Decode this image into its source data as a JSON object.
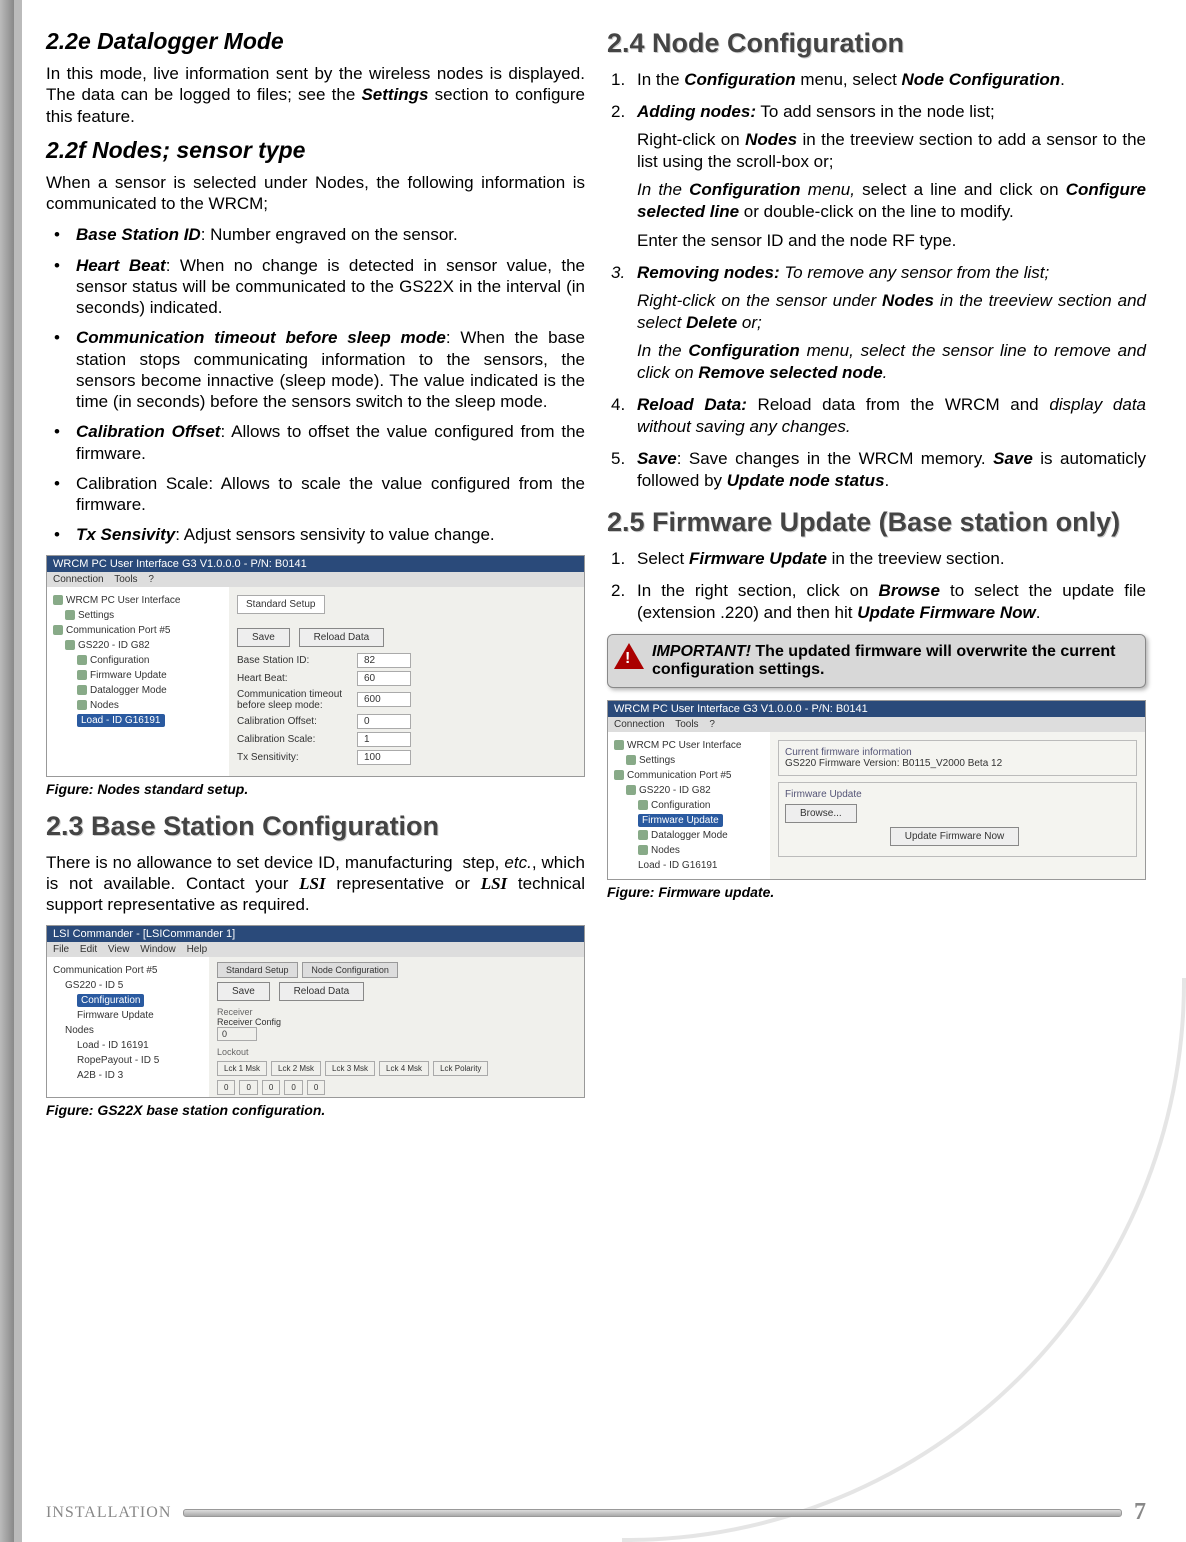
{
  "left": {
    "s22e_title": "2.2e   Datalogger Mode",
    "s22e_p": "In this mode, live information sent by the wireless nodes is displayed. The data can be logged to files; see the Settings section to configure this feature.",
    "s22f_title": "2.2f   Nodes; sensor type",
    "s22f_intro": "When a sensor is selected under Nodes, the following information is communicated to the WRCM;",
    "bullets": [
      {
        "b": "Base Station ID",
        "t": ": Number engraved on the sensor."
      },
      {
        "b": "Heart Beat",
        "t": ": When no change is detected in sensor value, the sensor status will be communicated to the GS22X in the interval (in seconds) indicated."
      },
      {
        "b": "Communication timeout before sleep mode",
        "t": ": When the base station stops communicating information to the sensors, the sensors become innactive (sleep mode). The value indicated is the time (in seconds) before the sensors switch to the sleep mode."
      },
      {
        "b": "Calibration Offset",
        "t": ": Allows to offset the value configured from the firmware."
      },
      {
        "b": "",
        "t": "Calibration Scale: Allows to scale the value configured from the firmware."
      },
      {
        "b": "Tx Sensivity",
        "t": ": Adjust sensors sensivity to value change."
      }
    ],
    "fig1_title": "WRCM PC User Interface G3 V1.0.0.0 - P/N: B0141",
    "fig1_menu": [
      "Connection",
      "Tools",
      "?"
    ],
    "fig1_tree": {
      "root": "WRCM PC User Interface",
      "settings": "Settings",
      "port": "Communication Port #5",
      "gs": "GS220 - ID G82",
      "cfg": "Configuration",
      "fw": "Firmware Update",
      "dl": "Datalogger Mode",
      "nodes": "Nodes",
      "load": "Load - ID G16191"
    },
    "fig1_panel": {
      "hdr": "Standard Setup",
      "save": "Save",
      "reload": "Reload Data",
      "f1": "Base Station ID:",
      "v1": "82",
      "f2": "Heart Beat:",
      "v2": "60",
      "f3": "Communication timeout before sleep mode:",
      "v3": "600",
      "f4": "Calibration Offset:",
      "v4": "0",
      "f5": "Calibration Scale:",
      "v5": "1",
      "f6": "Tx Sensitivity:",
      "v6": "100"
    },
    "fig1_cap": "Figure:  Nodes standard setup.",
    "s23_title": "2.3 Base Station Configuration",
    "s23_p": "There is no allowance to set device ID, manufacturing  step, etc., which is not available. Contact your LSI representative or LSI technical support representative as required.",
    "fig2_title": "LSI Commander - [LSICommander 1]",
    "fig2_menu": [
      "File",
      "Edit",
      "View",
      "Window",
      "Help"
    ],
    "fig2_tree": {
      "port": "Communication Port #5",
      "gs": "GS220 - ID 5",
      "cfg": "Configuration",
      "fw": "Firmware Update",
      "nodes": "Nodes",
      "a": "Load - ID 16191",
      "b": "RopePayout - ID 5",
      "c": "A2B - ID 3"
    },
    "fig2_panel": {
      "tab1": "Standard Setup",
      "tab2": "Node Configuration",
      "save": "Save",
      "reload": "Reload Data",
      "recv": "Receiver",
      "rcfg": "Receiver Config",
      "zero": "0",
      "lock": "Lockout",
      "lk": [
        "Lck 1 Msk",
        "Lck 2 Msk",
        "Lck 3 Msk",
        "Lck 4 Msk",
        "Lck Polarity"
      ],
      "lkv": [
        "0",
        "0",
        "0",
        "0",
        "0"
      ]
    },
    "fig2_cap": "Figure:  GS22X base station configuration."
  },
  "right": {
    "s24_title": "2.4 Node Configuration",
    "s24_steps": [
      {
        "n": "1.",
        "parts": [
          {
            "t": "In the ",
            "b": false
          },
          {
            "t": "Configuration",
            "b": true,
            "i": true
          },
          {
            "t": " menu, select ",
            "b": false
          },
          {
            "t": "Node Configuration",
            "b": true,
            "i": true
          },
          {
            "t": ".",
            "b": false
          }
        ]
      },
      {
        "n": "2.",
        "sub": [
          "Adding nodes: To add sensors in the node list;",
          "Right-click on Nodes in the treeview section to add a sensor to the list using the scroll-box or;",
          "In the Configuration menu, select a line and click on Configure selected line or double-click on the line to modify.",
          "Enter the sensor ID and the node RF type."
        ]
      },
      {
        "n": "3.",
        "italic": true,
        "sub": [
          "Removing nodes: To remove any sensor from the list;",
          "Right-click on the sensor under Nodes in the treeview section and select Delete or;",
          "In the Configuration menu, select the sensor line to remove and click on Remove selected node."
        ]
      },
      {
        "n": "4.",
        "line": "Reload Data: Reload data from the WRCM and display data without saving any changes."
      },
      {
        "n": "5.",
        "line": "Save: Save changes in the WRCM memory. Save is automaticly followed by Update node status."
      }
    ],
    "s25_title": "2.5 Firmware Update (Base station only)",
    "s25_steps": [
      {
        "n": "1.",
        "line": "Select Firmware Update in the treeview section."
      },
      {
        "n": "2.",
        "sub": [
          "In the right section, click on Browse to select the update file (extension .220) and then hit Update Firmware Now."
        ]
      }
    ],
    "alert_lead": "IMPORTANT!",
    "alert_rest": "  The updated firmware will overwrite the current configuration settings.",
    "fig3_title": "WRCM PC User Interface G3 V1.0.0.0 - P/N: B0141",
    "fig3_menu": [
      "Connection",
      "Tools",
      "?"
    ],
    "fig3_tree": {
      "root": "WRCM PC User Interface",
      "settings": "Settings",
      "port": "Communication Port #5",
      "gs": "GS220 - ID G82",
      "cfg": "Configuration",
      "fw": "Firmware Update",
      "dl": "Datalogger Mode",
      "nodes": "Nodes",
      "load": "Load - ID G16191"
    },
    "fig3_panel": {
      "g1": "Current firmware information",
      "ver": "GS220 Firmware Version: B0115_V2000 Beta 12",
      "g2": "Firmware Update",
      "browse": "Browse...",
      "upd": "Update Firmware Now"
    },
    "fig3_cap": "Figure:  Firmware update."
  },
  "footer": {
    "label": "INSTALLATION",
    "page": "7"
  }
}
